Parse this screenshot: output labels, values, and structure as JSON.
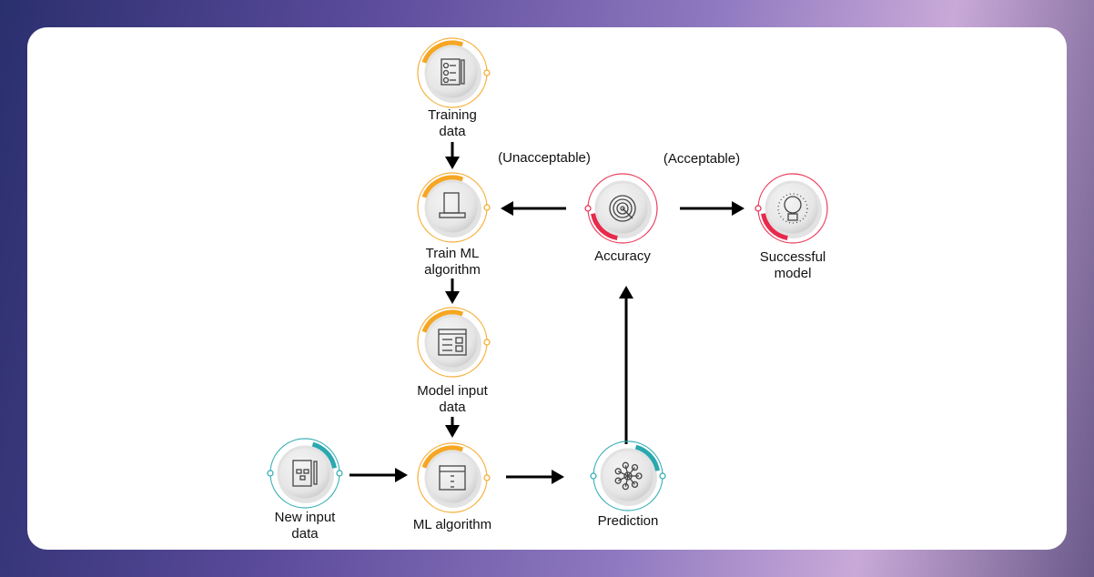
{
  "colors": {
    "orange": "#f5a623",
    "red": "#e8294b",
    "teal": "#2aa8b0",
    "arrow": "#000000"
  },
  "nodes": [
    {
      "id": "training-data",
      "label_lines": [
        "Training",
        "data"
      ],
      "icon": "checklist-icon",
      "color": "orange"
    },
    {
      "id": "train-ml-algorithm",
      "label_lines": [
        "Train ML",
        "algorithm"
      ],
      "icon": "laptop-code-icon",
      "color": "orange"
    },
    {
      "id": "model-input-data",
      "label_lines": [
        "Model input",
        "data"
      ],
      "icon": "form-window-icon",
      "color": "orange"
    },
    {
      "id": "ml-algorithm",
      "label_lines": [
        "ML algorithm"
      ],
      "icon": "window-icon",
      "color": "orange"
    },
    {
      "id": "new-input-data",
      "label_lines": [
        "New input",
        "data"
      ],
      "icon": "flowchart-document-icon",
      "color": "teal"
    },
    {
      "id": "prediction",
      "label_lines": [
        "Prediction"
      ],
      "icon": "network-icon",
      "color": "teal"
    },
    {
      "id": "accuracy",
      "label_lines": [
        "Accuracy"
      ],
      "icon": "target-icon",
      "color": "red"
    },
    {
      "id": "successful-model",
      "label_lines": [
        "Successful",
        "model"
      ],
      "icon": "lightbulb-icon",
      "color": "red"
    }
  ],
  "edge_labels": {
    "unacceptable": "(Unacceptable)",
    "acceptable": "(Acceptable)"
  }
}
